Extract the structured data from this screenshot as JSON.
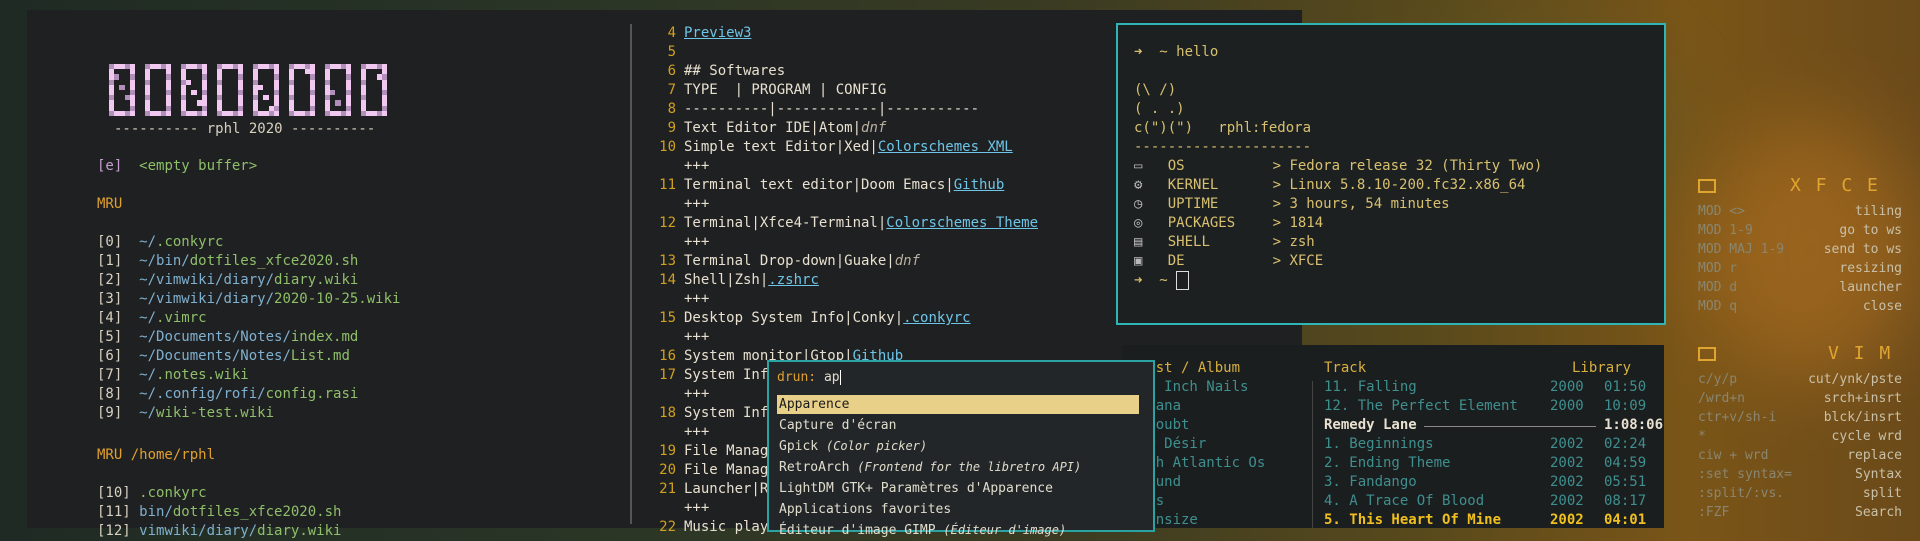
{
  "left": {
    "logo": "DOTFILES",
    "subtitle": "---------- rphl 2020 ----------",
    "empty": {
      "key": "[e]",
      "label": "<empty buffer>"
    },
    "mru_title": "MRU",
    "mru": [
      {
        "k": "[0]",
        "dir": "~/",
        "file": ".conkyrc"
      },
      {
        "k": "[1]",
        "dir": "~/bin/",
        "file": "dotfiles_xfce2020.sh"
      },
      {
        "k": "[2]",
        "dir": "~/vimwiki/diary/",
        "file": "diary.wiki"
      },
      {
        "k": "[3]",
        "dir": "~/vimwiki/diary/",
        "file": "2020-10-25.wiki"
      },
      {
        "k": "[4]",
        "dir": "~/",
        "file": ".vimrc"
      },
      {
        "k": "[5]",
        "dir": "~/Documents/Notes/",
        "file": "index.md"
      },
      {
        "k": "[6]",
        "dir": "~/Documents/Notes/",
        "file": "List.md"
      },
      {
        "k": "[7]",
        "dir": "~/",
        "file": ".notes.wiki"
      },
      {
        "k": "[8]",
        "dir": "~/.config/rofi/",
        "file": "config.rasi"
      },
      {
        "k": "[9]",
        "dir": "~/",
        "file": "wiki-test.wiki"
      }
    ],
    "mru2_title": "MRU /home/rphl",
    "mru2": [
      {
        "k": "[10]",
        "dir": "",
        "file": ".conkyrc"
      },
      {
        "k": "[11]",
        "dir": "bin/",
        "file": "dotfiles_xfce2020.sh"
      },
      {
        "k": "[12]",
        "dir": "vimwiki/diary/",
        "file": "diary.wiki"
      }
    ]
  },
  "editor": {
    "lines": [
      {
        "n": "4",
        "t": "",
        "l": "Preview3"
      },
      {
        "n": "5",
        "t": ""
      },
      {
        "n": "6",
        "t": "## Softwares"
      },
      {
        "n": "7",
        "t": "TYPE  | PROGRAM | CONFIG"
      },
      {
        "n": "8",
        "t": "----------|------------|-----------"
      },
      {
        "n": "9",
        "t": "Text Editor IDE|Atom|",
        "i": "dnf"
      },
      {
        "n": "10",
        "t": "Simple text Editor|Xed|",
        "l": "Colorschemes XML"
      },
      {
        "n": "",
        "t": "+++"
      },
      {
        "n": "11",
        "t": "Terminal text editor|Doom Emacs|",
        "l": "Github"
      },
      {
        "n": "",
        "t": "+++"
      },
      {
        "n": "12",
        "t": "Terminal|Xfce4-Terminal|",
        "l": "Colorschemes Theme"
      },
      {
        "n": "",
        "t": "+++"
      },
      {
        "n": "13",
        "t": "Terminal Drop-down|Guake|",
        "i": "dnf"
      },
      {
        "n": "14",
        "t": "Shell|Zsh|",
        "l": ".zshrc"
      },
      {
        "n": "",
        "t": "+++"
      },
      {
        "n": "15",
        "t": "Desktop System Info|Conky|",
        "l": ".conkyrc"
      },
      {
        "n": "",
        "t": "+++"
      },
      {
        "n": "16",
        "t": "System monitor|Gtop|",
        "l": "Github"
      },
      {
        "n": "17",
        "t": "System Info"
      },
      {
        "n": "",
        "t": "+++"
      },
      {
        "n": "18",
        "t": "System Info"
      },
      {
        "n": "",
        "t": "+++"
      },
      {
        "n": "19",
        "t": "File Manage"
      },
      {
        "n": "20",
        "t": "File Manage"
      },
      {
        "n": "21",
        "t": "Launcher|Ro"
      },
      {
        "n": "",
        "t": "+++"
      },
      {
        "n": "22",
        "t": "Music playe"
      }
    ]
  },
  "terminal": {
    "prompt": "➜  ~ hello",
    "art": [
      "(\\ /)",
      "( . .)",
      "c(\")(\")   rphl:fedora"
    ],
    "sep": "---------------------",
    "rows": [
      {
        "icon": "laptop-icon",
        "k": "OS",
        "v": "Fedora release 32 (Thirty Two)"
      },
      {
        "icon": "gear-icon",
        "k": "KERNEL",
        "v": "Linux 5.8.10-200.fc32.x86_64"
      },
      {
        "icon": "clock-icon",
        "k": "UPTIME",
        "v": "3 hours, 54 minutes"
      },
      {
        "icon": "package-icon",
        "k": "PACKAGES",
        "v": "1814"
      },
      {
        "icon": "terminal-icon",
        "k": "SHELL",
        "v": "zsh"
      },
      {
        "icon": "window-icon",
        "k": "DE",
        "v": "XFCE"
      }
    ],
    "prompt2": "➜  ~"
  },
  "music": {
    "col1": "Artist / Album",
    "col2": "Track",
    "col3": "Library",
    "artists": [
      "Nine Inch Nails",
      "Nirvana",
      "No Doubt",
      "Noir Désir",
      "North Atlantic Os",
      "Nosound",
      "Oasis",
      "Oceansize"
    ],
    "tracks": [
      {
        "t": "11. Falling",
        "y": "2000",
        "d": "01:50"
      },
      {
        "t": "12. The Perfect Element",
        "y": "2000",
        "d": "10:09"
      },
      {
        "album": "Remedy Lane",
        "d": "1:08:06"
      },
      {
        "t": "1. Beginnings",
        "y": "2002",
        "d": "02:24"
      },
      {
        "t": "2. Ending Theme",
        "y": "2002",
        "d": "04:59"
      },
      {
        "t": "3. Fandango",
        "y": "2002",
        "d": "05:51"
      },
      {
        "t": "4. A Trace Of Blood",
        "y": "2002",
        "d": "08:17"
      },
      {
        "t": "5. This Heart Of Mine",
        "y": "2002",
        "d": "04:01"
      }
    ]
  },
  "rofi": {
    "prompt": "drun:",
    "query": "ap",
    "items": [
      {
        "name": "Apparence",
        "desc": ""
      },
      {
        "name": "Capture d'écran",
        "desc": ""
      },
      {
        "name": "Gpick",
        "desc": "(Color picker)"
      },
      {
        "name": "RetroArch",
        "desc": "(Frontend for the libretro API)"
      },
      {
        "name": "LightDM GTK+ Paramètres d'Apparence",
        "desc": ""
      },
      {
        "name": "Applications favorites",
        "desc": ""
      },
      {
        "name": "Éditeur d'image GIMP",
        "desc": "(Éditeur d'image)"
      }
    ]
  },
  "sidebar": {
    "xfce_title": "X F C E",
    "xfce": [
      [
        "MOD <>",
        "tiling"
      ],
      [
        "MOD 1-9",
        "go to ws"
      ],
      [
        "MOD MAJ 1-9",
        "send to ws"
      ],
      [
        "MOD r",
        "resizing"
      ],
      [
        "MOD d",
        "launcher"
      ],
      [
        "MOD q",
        "close"
      ]
    ],
    "vim_title": "V I M",
    "vim": [
      [
        "c/y/p",
        "cut/ynk/pste"
      ],
      [
        "/wrd+n",
        "srch+insrt"
      ],
      [
        "ctr+v/sh-i",
        "blck/insrt"
      ],
      [
        "*",
        "cycle wrd"
      ],
      [
        "ciw + wrd",
        "replace"
      ],
      [
        ":set syntax=",
        "Syntax"
      ],
      [
        ":split/:vs.",
        "split"
      ],
      [
        ":FZF",
        "Search"
      ]
    ]
  }
}
